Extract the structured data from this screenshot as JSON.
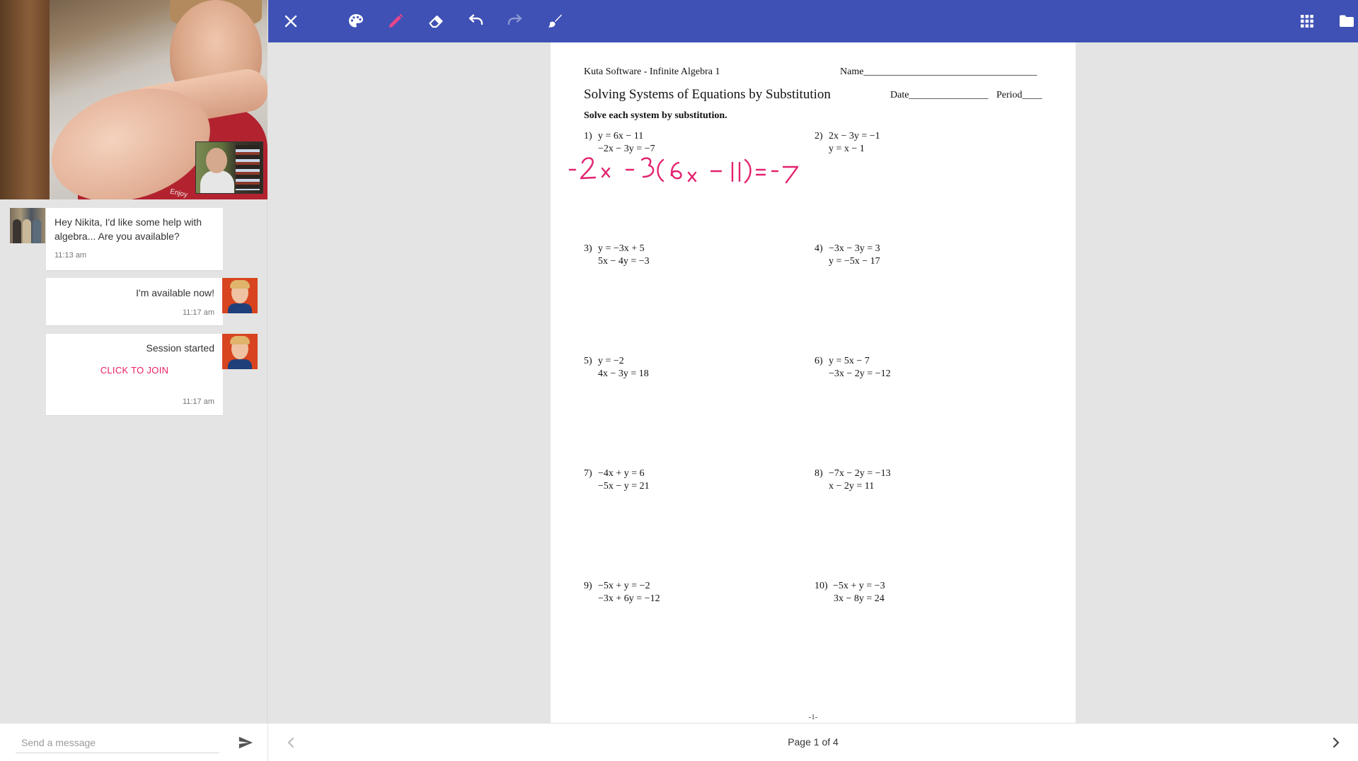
{
  "toolbar": {
    "color": "#3f51b5",
    "tools": [
      "close-icon",
      "palette-icon",
      "pencil-icon",
      "eraser-icon",
      "undo-icon",
      "redo-icon",
      "clear-brush-icon",
      "grid-apps-icon",
      "folder-icon"
    ],
    "active_tool": "pencil-icon",
    "pencil_color": "#e8458b"
  },
  "video": {
    "shirt_text": "Enjoy"
  },
  "chat": {
    "messages": [
      {
        "text": "Hey Nikita, I'd like some help with algebra... Are you available?",
        "time": "11:13 am"
      },
      {
        "text": "I'm available now!",
        "time": "11:17 am"
      },
      {
        "text": "Session started",
        "action": "CLICK TO JOIN",
        "time": "11:17 am"
      }
    ],
    "action_color": "#e91e63",
    "input_placeholder": "Send a message"
  },
  "worksheet": {
    "header_left": "Kuta Software - Infinite Algebra 1",
    "name_label": "Name___________________________________",
    "title": "Solving Systems of Equations by Substitution",
    "date_label": "Date________________",
    "period_label": "Period____",
    "instructions": "Solve each system by substitution.",
    "problems": [
      {
        "num": "1)",
        "line1": "y = 6x − 11",
        "line2": "−2x − 3y = −7"
      },
      {
        "num": "2)",
        "line1": "2x − 3y = −1",
        "line2": "y = x − 1"
      },
      {
        "num": "3)",
        "line1": "y = −3x + 5",
        "line2": "5x − 4y = −3"
      },
      {
        "num": "4)",
        "line1": "−3x − 3y = 3",
        "line2": "y = −5x − 17"
      },
      {
        "num": "5)",
        "line1": "y = −2",
        "line2": "4x − 3y = 18"
      },
      {
        "num": "6)",
        "line1": "y = 5x − 7",
        "line2": "−3x − 2y = −12"
      },
      {
        "num": "7)",
        "line1": "−4x + y = 6",
        "line2": "−5x − y = 21"
      },
      {
        "num": "8)",
        "line1": "−7x − 2y = −13",
        "line2": "x − 2y = 11"
      },
      {
        "num": "9)",
        "line1": "−5x + y = −2",
        "line2": "−3x + 6y = −12"
      },
      {
        "num": "10)",
        "line1": "−5x + y = −3",
        "line2": "3x − 8y = 24"
      }
    ],
    "handwritten_work": "-2x -3(6x -11) = -7",
    "handwriting_color": "#e3226f",
    "page_mark": "-1-"
  },
  "pager": {
    "label": "Page 1 of 4"
  }
}
